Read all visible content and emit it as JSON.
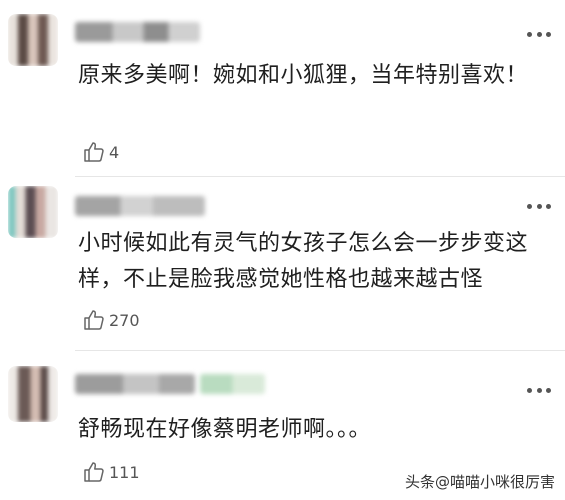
{
  "comments": [
    {
      "text": "原来多美啊！婉如和小狐狸，当年特别喜欢！",
      "likes": "4"
    },
    {
      "text": "小时候如此有灵气的女孩子怎么会一步步变这样，不止是脸我感觉她性格也越来越古怪",
      "likes": "270"
    },
    {
      "text": "舒畅现在好像蔡明老师啊。。。",
      "likes": "111"
    }
  ],
  "icons": {
    "like": "thumbs-up-icon",
    "more": "more-dots-icon"
  },
  "watermark": {
    "logo": "头条",
    "user": "@喵喵小咪很厉害"
  },
  "colors": {
    "text": "#1f1f1f",
    "meta": "#555555",
    "divider": "#e6e6e6"
  }
}
